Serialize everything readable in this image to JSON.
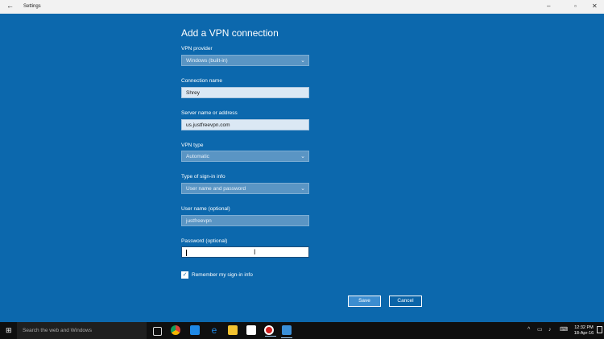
{
  "window": {
    "title": "Settings",
    "back_glyph": "←",
    "min_glyph": "–",
    "max_glyph": "▫",
    "close_glyph": "✕"
  },
  "form": {
    "heading": "Add a VPN connection",
    "vpn_provider": {
      "label": "VPN provider",
      "value": "Windows (built-in)"
    },
    "connection_name": {
      "label": "Connection name",
      "value": "Shrey"
    },
    "server": {
      "label": "Server name or address",
      "value": "us.justfreevpn.com"
    },
    "vpn_type": {
      "label": "VPN type",
      "value": "Automatic"
    },
    "signin_type": {
      "label": "Type of sign-in info",
      "value": "User name and password"
    },
    "username": {
      "label": "User name (optional)",
      "value": "justfreevpn"
    },
    "password": {
      "label": "Password (optional)",
      "value": ""
    },
    "remember": {
      "label": "Remember my sign-in info",
      "checked": true
    },
    "save_label": "Save",
    "cancel_label": "Cancel"
  },
  "taskbar": {
    "search_placeholder": "Search the web and Windows",
    "time": "12:32 PM",
    "date": "18-Apr-16",
    "icons": [
      "task-view",
      "chrome",
      "store-bag",
      "edge",
      "file-explorer",
      "store",
      "record",
      "settings"
    ]
  },
  "colors": {
    "accent": "#0a64a8",
    "taskbar": "#0f0f0f"
  }
}
